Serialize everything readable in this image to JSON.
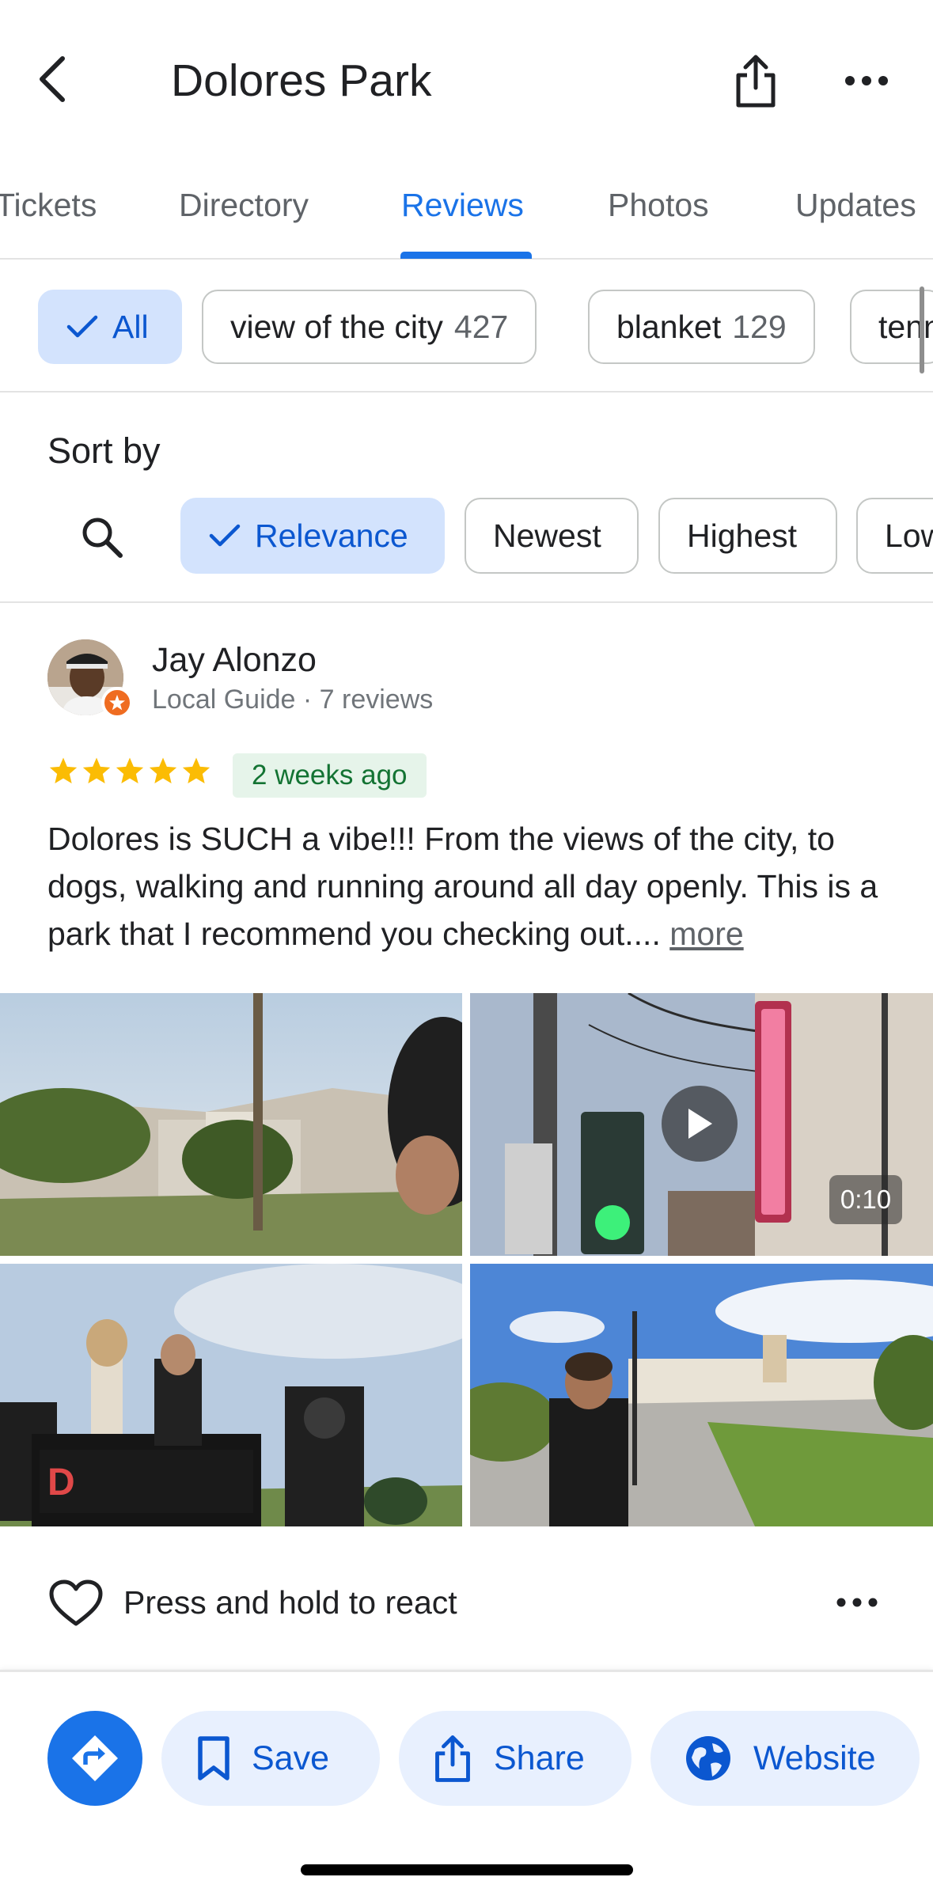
{
  "header": {
    "title": "Dolores Park",
    "back_icon": "chevron-left-icon",
    "share_icon": "share-icon",
    "more_icon": "more-horizontal-icon"
  },
  "tabs": [
    {
      "label": "Tickets",
      "active": false
    },
    {
      "label": "Directory",
      "active": false
    },
    {
      "label": "Reviews",
      "active": true
    },
    {
      "label": "Photos",
      "active": false
    },
    {
      "label": "Updates",
      "active": false
    }
  ],
  "topics": [
    {
      "label": "All",
      "count": "",
      "active": true
    },
    {
      "label": "view of the city",
      "count": "427",
      "active": false
    },
    {
      "label": "blanket",
      "count": "129",
      "active": false
    },
    {
      "label": "tenn",
      "count": "",
      "active": false
    }
  ],
  "sort": {
    "label": "Sort by",
    "search_icon": "search-icon",
    "options": [
      {
        "label": "Relevance",
        "active": true
      },
      {
        "label": "Newest",
        "active": false
      },
      {
        "label": "Highest",
        "active": false
      },
      {
        "label": "Low",
        "active": false
      }
    ]
  },
  "review": {
    "author": "Jay Alonzo",
    "meta": "Local Guide · 7 reviews",
    "rating": 5,
    "rating_max": 5,
    "time": "2 weeks ago",
    "text": "Dolores is SUCH a vibe!!! From the views of the city, to dogs, walking and running around all day openly. This is a park that I recommend you checking out....",
    "more": "more",
    "video_duration": "0:10",
    "photo_count": 4
  },
  "react": {
    "label": "Press and hold to react",
    "heart_icon": "heart-outline-icon",
    "more_icon": "more-horizontal-icon"
  },
  "bottom_bar": {
    "directions_icon": "directions-icon",
    "save": "Save",
    "share": "Share",
    "website": "Website"
  },
  "colors": {
    "accent": "#1a73e8",
    "chip_active_bg": "#d3e3fd",
    "star": "#fbbc04",
    "time_badge_bg": "#e6f4ea",
    "time_badge_text": "#137333"
  }
}
